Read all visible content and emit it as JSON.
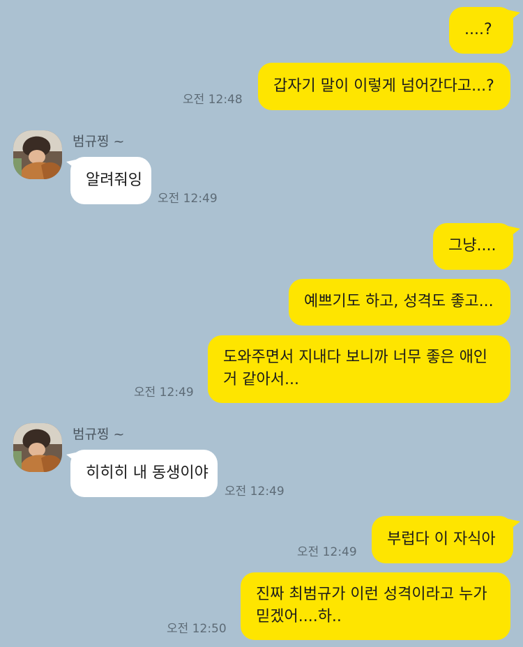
{
  "chat": {
    "messages": [
      {
        "id": "m1",
        "side": "me",
        "text": "....?"
      },
      {
        "id": "m2",
        "side": "me",
        "text": "갑자기 말이 이렇게 넘어간다고...?",
        "time": "오전 12:48"
      },
      {
        "id": "m3",
        "side": "them",
        "sender": "범규찡 ~",
        "text": "알려줘잉",
        "time": "오전 12:49"
      },
      {
        "id": "m4",
        "side": "me",
        "text": "그냥...."
      },
      {
        "id": "m5",
        "side": "me",
        "text": "예쁘기도 하고, 성격도 좋고..."
      },
      {
        "id": "m6",
        "side": "me",
        "lines": [
          "도와주면서 지내다 보니까 너무 좋은 애인",
          "거 같아서..."
        ],
        "time": "오전 12:49"
      },
      {
        "id": "m7",
        "side": "them",
        "sender": "범규찡 ~",
        "text": "히히히 내 동생이야",
        "time": "오전 12:49"
      },
      {
        "id": "m8",
        "side": "me",
        "text": "부럽다 이 자식아",
        "time": "오전 12:49"
      },
      {
        "id": "m9",
        "side": "me",
        "lines": [
          "진짜 최범규가 이런 성격이라고 누가",
          "믿겠어....하.."
        ],
        "time": "오전 12:50"
      }
    ]
  },
  "colors": {
    "background": "#abc1d1",
    "my_bubble": "#fee500",
    "their_bubble": "#ffffff",
    "timestamp": "#5d6b76"
  }
}
